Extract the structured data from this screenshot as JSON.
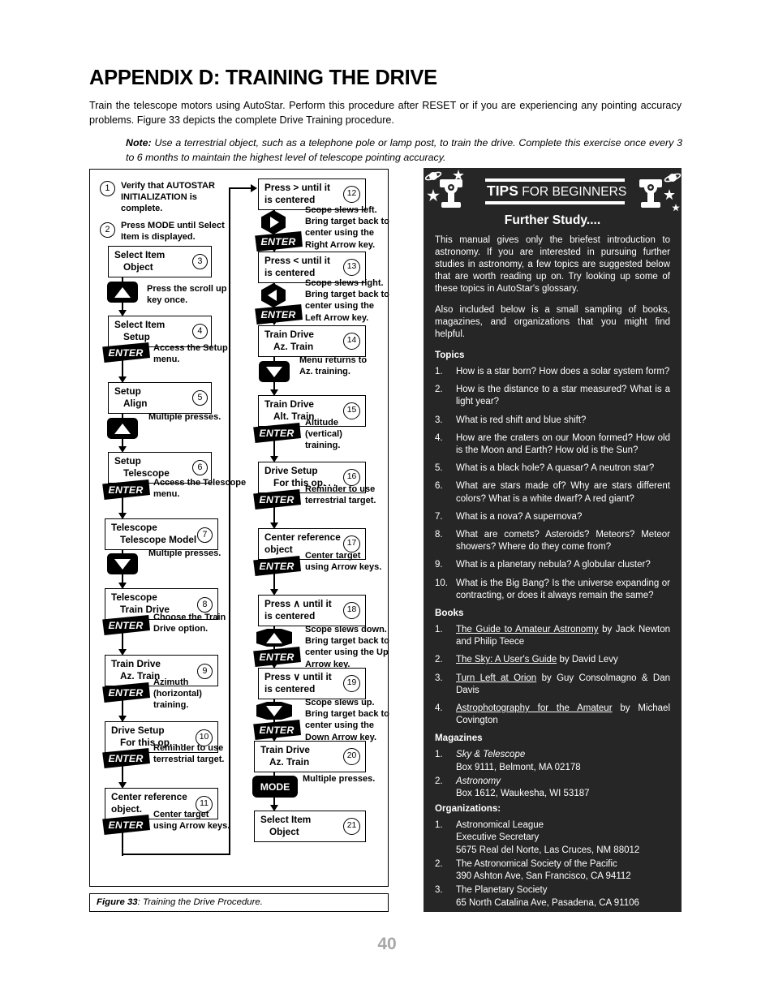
{
  "header": {
    "title": "APPENDIX D: TRAINING THE DRIVE",
    "intro": "Train the telescope motors using AutoStar. Perform this procedure after RESET or if you are experiencing any pointing accuracy problems. Figure 33 depicts the complete Drive Training procedure.",
    "note_label": "Note:",
    "note_text": " Use a terrestrial object, such as a telephone pole or lamp post, to train the drive. Complete this exercise once every 3 to 6 months to maintain the highest level of telescope pointing accuracy."
  },
  "figure": {
    "caption_label": "Figure 33",
    "caption_text": ": Training the Drive Procedure."
  },
  "flow": {
    "step1": {
      "num": "1",
      "text": "Verify that AUTOSTAR INITIALIZATION is complete."
    },
    "step2": {
      "num": "2",
      "text": "Press MODE until Select Item is displayed."
    },
    "step3": {
      "num": "3",
      "line1": "Select Item",
      "line2": "Object"
    },
    "ann3": "Press the scroll up key once.",
    "step4": {
      "num": "4",
      "line1": "Select Item",
      "line2": "Setup"
    },
    "ann4": "Access the Setup menu.",
    "step5": {
      "num": "5",
      "line1": "Setup",
      "line2": "Align"
    },
    "ann5": "Multiple presses.",
    "step6": {
      "num": "6",
      "line1": "Setup",
      "line2": "Telescope"
    },
    "ann6": "Access the Telescope menu.",
    "step7": {
      "num": "7",
      "line1": "Telescope",
      "line2": "Telescope Model"
    },
    "ann7": "Multiple presses.",
    "step8": {
      "num": "8",
      "line1": "Telescope",
      "line2": "Train Drive"
    },
    "ann8": "Choose the Train Drive option.",
    "step9": {
      "num": "9",
      "line1": "Train Drive",
      "line2": "Az. Train"
    },
    "ann9": "Azimuth (horizontal) training.",
    "step10": {
      "num": "10",
      "line1": "Drive Setup",
      "line2": "For this op. . ."
    },
    "ann10": "Reminder to use terrestrial target.",
    "step11": {
      "num": "11",
      "line1": "Center reference",
      "line2": "object."
    },
    "ann11": "Center target using Arrow keys.",
    "step12": {
      "num": "12",
      "line1": "Press  >  until it",
      "line2": "is centered"
    },
    "ann12": "Scope slews left. Bring target back to center using the Right Arrow key.",
    "step13": {
      "num": "13",
      "line1": "Press  <  until it",
      "line2": "is centered"
    },
    "ann13": "Scope slews right. Bring target back to center using the Left Arrow key.",
    "step14": {
      "num": "14",
      "line1": "Train Drive",
      "line2": "Az. Train"
    },
    "ann14": "Menu returns to Az. training.",
    "step15": {
      "num": "15",
      "line1": "Train Drive",
      "line2": "Alt. Train"
    },
    "ann15": "Altitude (vertical) training.",
    "step16": {
      "num": "16",
      "line1": "Drive Setup",
      "line2": "For this op. . ."
    },
    "ann16": "Reminder to use terrestrial target.",
    "step17": {
      "num": "17",
      "line1": "Center reference",
      "line2": "object"
    },
    "ann17": "Center target using Arrow keys.",
    "step18": {
      "num": "18",
      "line1": "Press ∧  until it",
      "line2": "is centered"
    },
    "ann18": "Scope slews down. Bring target back to center using the Up Arrow key.",
    "step19": {
      "num": "19",
      "line1": "Press ∨  until it",
      "line2": "is centered"
    },
    "ann19": "Scope slews up. Bring target back to center using the Down Arrow key.",
    "step20": {
      "num": "20",
      "line1": "Train Drive",
      "line2": "Az. Train"
    },
    "ann20": "Multiple presses.",
    "step21": {
      "num": "21",
      "line1": "Select Item",
      "line2": "Object"
    },
    "key_enter": "ENTER",
    "key_mode": "MODE"
  },
  "tips": {
    "title_bold": "TIPS",
    "title_light": " FOR BEGINNERS",
    "subtitle": "Further Study....",
    "para1": "This manual gives only the briefest introduction to astronomy. If you are interested in pursuing further studies in astronomy, a few topics are suggested below that are worth reading up on. Try looking up some of these topics in AutoStar's glossary.",
    "para2": "Also included below is a small sampling of books, magazines, and organizations that you might find helpful.",
    "topics_head": "Topics",
    "topics": [
      {
        "n": "1.",
        "t": "How is a star born? How does a solar system form?"
      },
      {
        "n": "2.",
        "t": "How is the distance to a star measured? What is a light year?"
      },
      {
        "n": "3.",
        "t": "What is red shift and blue shift?"
      },
      {
        "n": "4.",
        "t": "How are the craters on our Moon formed? How old is the Moon and Earth? How old is the Sun?"
      },
      {
        "n": "5.",
        "t": "What is a black hole? A quasar? A neutron star?"
      },
      {
        "n": "6.",
        "t": "What are stars made of?  Why are stars different colors? What is a white dwarf?  A red giant?"
      },
      {
        "n": "7.",
        "t": "What is a nova? A supernova?"
      },
      {
        "n": "8.",
        "t": "What are comets? Asteroids? Meteors? Meteor showers? Where do they come from?"
      },
      {
        "n": "9.",
        "t": "What is a planetary nebula? A globular cluster?"
      },
      {
        "n": "10.",
        "t": "What is the Big Bang? Is the universe expanding or contracting, or does it always remain the same?"
      }
    ],
    "books_head": "Books",
    "books": [
      {
        "n": "1.",
        "title": "The Guide to Amateur Astronomy",
        "author": " by Jack Newton and Philip Teece"
      },
      {
        "n": "2.",
        "title": "The Sky: A User's Guide",
        "author": " by David Levy"
      },
      {
        "n": "3.",
        "title": "Turn Left at Orion",
        "author": " by Guy Consolmagno & Dan Davis"
      },
      {
        "n": "4.",
        "title": "Astrophotography for the Amateur",
        "author": " by Michael Covington"
      }
    ],
    "magazines_head": "Magazines",
    "magazines": [
      {
        "n": "1.",
        "name": "Sky & Telescope",
        "addr": "Box 9111, Belmont, MA 02178"
      },
      {
        "n": "2.",
        "name": "Astronomy",
        "addr": "Box 1612, Waukesha, WI 53187"
      }
    ],
    "orgs_head": "Organizations:",
    "orgs": [
      {
        "n": "1.",
        "l1": "Astronomical League",
        "l2": "Executive Secretary",
        "l3": "5675 Real del Norte, Las Cruces, NM 88012"
      },
      {
        "n": "2.",
        "l1": "The Astronomical Society of the Pacific",
        "l2": "390 Ashton Ave, San Francisco, CA 94112",
        "l3": ""
      },
      {
        "n": "3.",
        "l1": "The Planetary Society",
        "l2": "65 North Catalina Ave, Pasadena, CA 91106",
        "l3": ""
      }
    ]
  },
  "page_number": "40"
}
